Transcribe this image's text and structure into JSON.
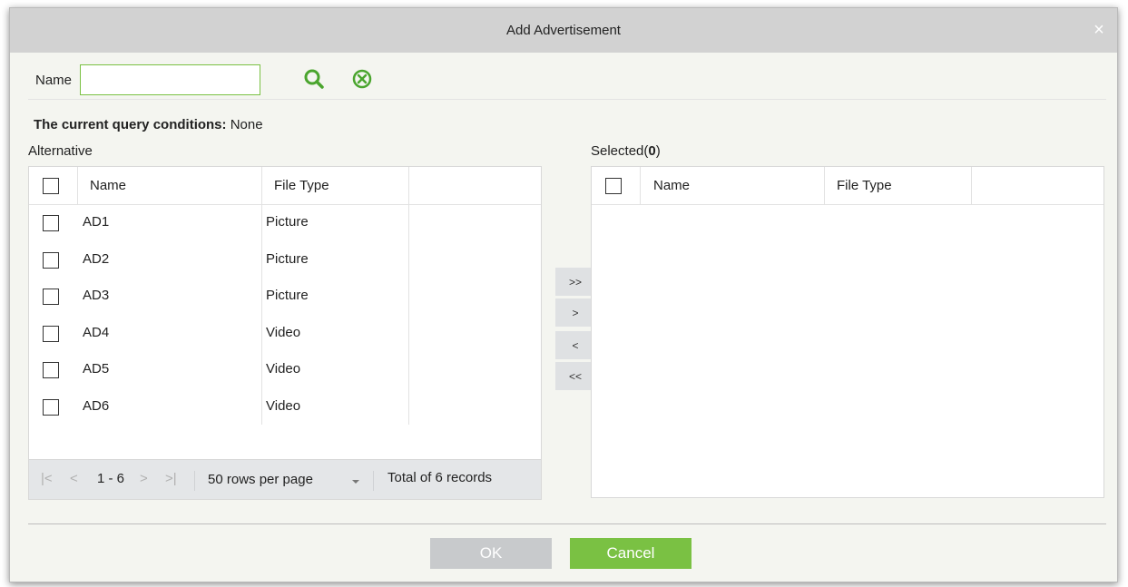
{
  "dialog": {
    "title": "Add Advertisement",
    "close_icon": "×"
  },
  "search": {
    "name_label": "Name",
    "name_value": "",
    "search_icon": "search-icon",
    "clear_icon": "clear-circle-icon"
  },
  "query": {
    "label": "The current query conditions:",
    "value": "None"
  },
  "alternative": {
    "label": "Alternative",
    "columns": [
      "Name",
      "File Type"
    ],
    "rows": [
      {
        "name": "AD1",
        "type": "Picture"
      },
      {
        "name": "AD2",
        "type": "Picture"
      },
      {
        "name": "AD3",
        "type": "Picture"
      },
      {
        "name": "AD4",
        "type": "Video"
      },
      {
        "name": "AD5",
        "type": "Video"
      },
      {
        "name": "AD6",
        "type": "Video"
      }
    ],
    "pager": {
      "first": "|<",
      "prev": "<",
      "range": "1 - 6",
      "next": ">",
      "last": ">|",
      "per_page": "50 rows per page",
      "total": "Total of 6 records"
    }
  },
  "selected": {
    "label_prefix": "Selected(",
    "count": "0",
    "label_suffix": ")",
    "columns": [
      "Name",
      "File Type"
    ]
  },
  "move_buttons": {
    "all_right": ">>",
    "right": ">",
    "left": "<",
    "all_left": "<<"
  },
  "footer": {
    "ok": "OK",
    "cancel": "Cancel"
  },
  "colors": {
    "accent": "#7ac143",
    "titlebar": "#d2d2d2",
    "disabled_button": "#c8cacc",
    "dialog_background": "#f4f5f0"
  }
}
